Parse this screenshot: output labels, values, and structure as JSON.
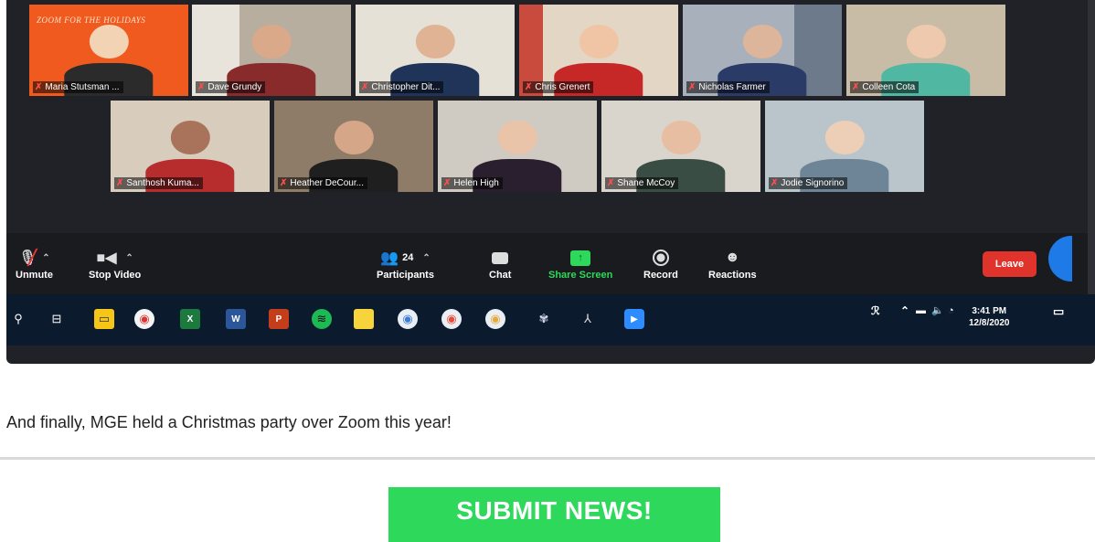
{
  "participants_tiles": [
    {
      "name": "Maria Stutsman ...",
      "banner": "ZOOM FOR THE HOLIDAYS"
    },
    {
      "name": "Dave Grundy"
    },
    {
      "name": "Christopher Dit..."
    },
    {
      "name": "Chris Grenert"
    },
    {
      "name": "Nicholas Farmer"
    },
    {
      "name": "Colleen Cota"
    },
    {
      "name": "Santhosh Kuma..."
    },
    {
      "name": "Heather DeCour..."
    },
    {
      "name": "Helen High"
    },
    {
      "name": "Shane McCoy"
    },
    {
      "name": "Jodie Signorino"
    }
  ],
  "toolbar": {
    "unmute": "Unmute",
    "stop_video": "Stop Video",
    "participants": "Participants",
    "participants_count": "24",
    "chat": "Chat",
    "share_screen": "Share Screen",
    "record": "Record",
    "reactions": "Reactions",
    "leave": "Leave"
  },
  "taskbar": {
    "time": "3:41 PM",
    "date": "12/8/2020"
  },
  "colors": {
    "leave": "#e0332b",
    "share_green": "#2ed85a",
    "submit_green": "#2ed85a"
  },
  "caption": "And finally, MGE held a Christmas party over Zoom this year!",
  "submit_button": "SUBMIT NEWS!"
}
